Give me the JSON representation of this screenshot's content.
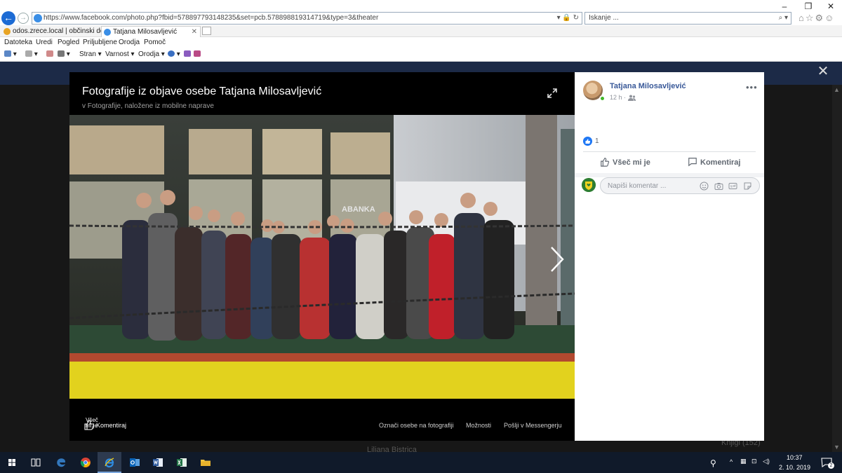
{
  "browser": {
    "url": "https://www.facebook.com/photo.php?fbid=578897793148235&set=pcb.578898819314719&type=3&theater",
    "search_placeholder": "Iskanje ...",
    "tabs": [
      {
        "label": "odos.zrece.local | občinski doku...",
        "active": false
      },
      {
        "label": "Tatjana Milosavljević",
        "active": true
      }
    ],
    "menu": [
      "Datoteka",
      "Uredi",
      "Pogled",
      "Priljubljene",
      "Orodja",
      "Pomoč"
    ],
    "command_bar": [
      "Stran ▾",
      "Varnost ▾",
      "Orodja ▾"
    ],
    "window_controls": [
      "–",
      "❐",
      "✕"
    ]
  },
  "viewer": {
    "title": "Fotografije iz objave osebe Tatjana Milosavljević",
    "subtitle": "v Fotografije, naložene iz mobilne naprave",
    "photo_sign": "ABANKA",
    "footer": {
      "like_label": "Všeč mi je",
      "comment_label": "Komentiraj",
      "tag_label": "Označi osebe na fotografiji",
      "options_label": "Možnosti",
      "messenger_label": "Pošlji v Messengerju"
    }
  },
  "post": {
    "author": "Tatjana Milosavljević",
    "time": "12 h",
    "like_count": "1",
    "like_action": "Všeč mi je",
    "comment_action": "Komentiraj",
    "comment_placeholder": "Napiši komentar ..."
  },
  "background": {
    "right_label": "Knjigi (152)",
    "bottom_label": "Liljana Bistrica"
  },
  "taskbar": {
    "time": "10:37",
    "date": "2. 10. 2019",
    "notifications": "2"
  },
  "colors": {
    "fb_blue": "#385898",
    "like_blue": "#2078f4",
    "backdrop": "#171717",
    "taskbar": "#101a2a"
  }
}
